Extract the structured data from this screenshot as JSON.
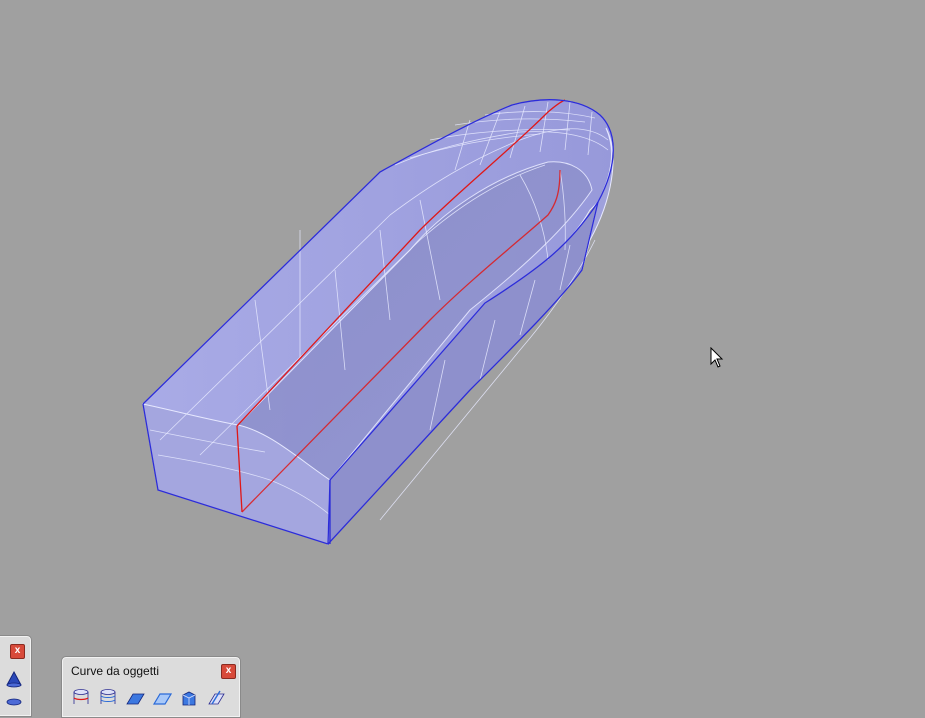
{
  "viewport": {
    "background_color": "#a0a0a0",
    "model": {
      "object": "boat-hull-surface",
      "face_color": "#9b9ee0",
      "edge_color": "#2c2cd8",
      "isocurve_color": "#e8eaff",
      "keel_curve_color": "#e01818"
    }
  },
  "left_toolbar": {
    "close_label": "x",
    "tools": [
      {
        "icon": "cone-icon"
      },
      {
        "icon": "cylinder-icon"
      }
    ]
  },
  "curve_toolbar": {
    "title": "Curve da oggetti",
    "close_label": "x",
    "tools": [
      {
        "icon": "cylinder-section-icon"
      },
      {
        "icon": "cylinder-contour-icon"
      },
      {
        "icon": "plane-section-icon"
      },
      {
        "icon": "surface-outline-icon"
      },
      {
        "icon": "box-edges-icon"
      },
      {
        "icon": "extract-isocurve-icon"
      }
    ]
  },
  "cursor": {
    "icon": "mouse-pointer-icon"
  }
}
